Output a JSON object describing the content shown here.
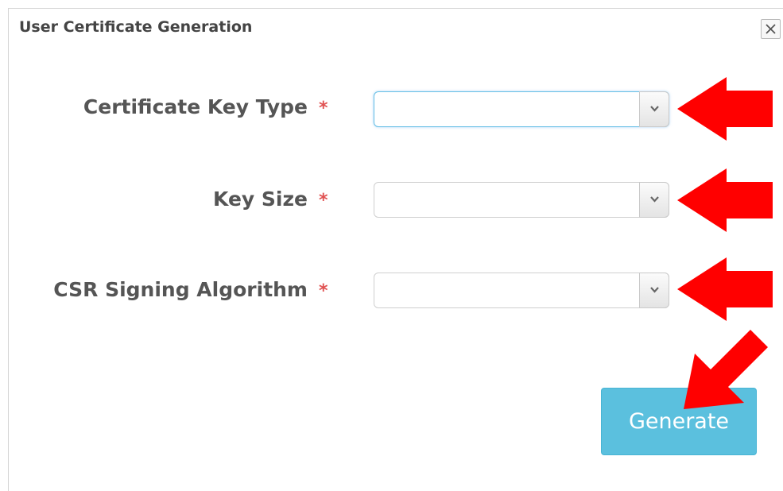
{
  "dialog": {
    "title": "User Certificate Generation",
    "close_icon": "close-icon"
  },
  "form": {
    "fields": [
      {
        "label": "Certificate Key Type",
        "required": "*",
        "value": "",
        "focused": true
      },
      {
        "label": "Key Size",
        "required": "*",
        "value": ""
      },
      {
        "label": "CSR Signing Algorithm",
        "required": "*",
        "value": ""
      }
    ]
  },
  "actions": {
    "generate_label": "Generate",
    "generate_color": "#5bc0de"
  },
  "annotations": {
    "arrow_color": "#ff0000",
    "arrow_icon": "red-arrow-icon"
  }
}
